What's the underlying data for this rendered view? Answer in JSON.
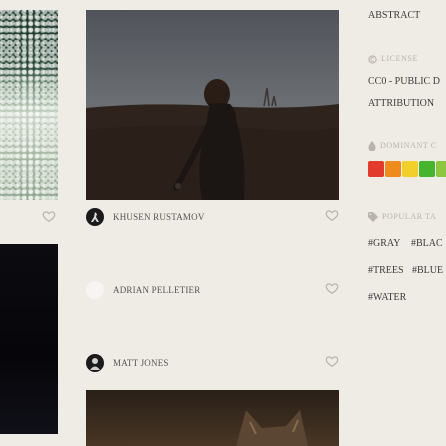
{
  "authors": [
    {
      "name": "KHUSEN RUSTAMOV"
    },
    {
      "name": "ADRIAN PELLETIER"
    },
    {
      "name": "MATT JONES"
    }
  ],
  "sidebar": {
    "category": "ABSTRACT",
    "license_heading": "LICENSE",
    "license_line1": "CC0 - PUBLIC D",
    "license_line2": "ATTRIBUTION",
    "colors_heading": "DOMINANT C",
    "colors": [
      "#e23a2c",
      "#ef8a1d",
      "#f2cf2a",
      "#45b42f",
      "#8dc63f"
    ],
    "tags_heading": "POPULAR TA",
    "tags": [
      [
        "#GRAY",
        "#BLAC"
      ],
      [
        "#TREES",
        "#BLUE"
      ],
      [
        "#WATER"
      ]
    ]
  },
  "icons": {
    "like": "heart-outline-icon",
    "license": "copyright-circle-icon",
    "colors": "drop-icon",
    "tags": "tag-icon"
  }
}
